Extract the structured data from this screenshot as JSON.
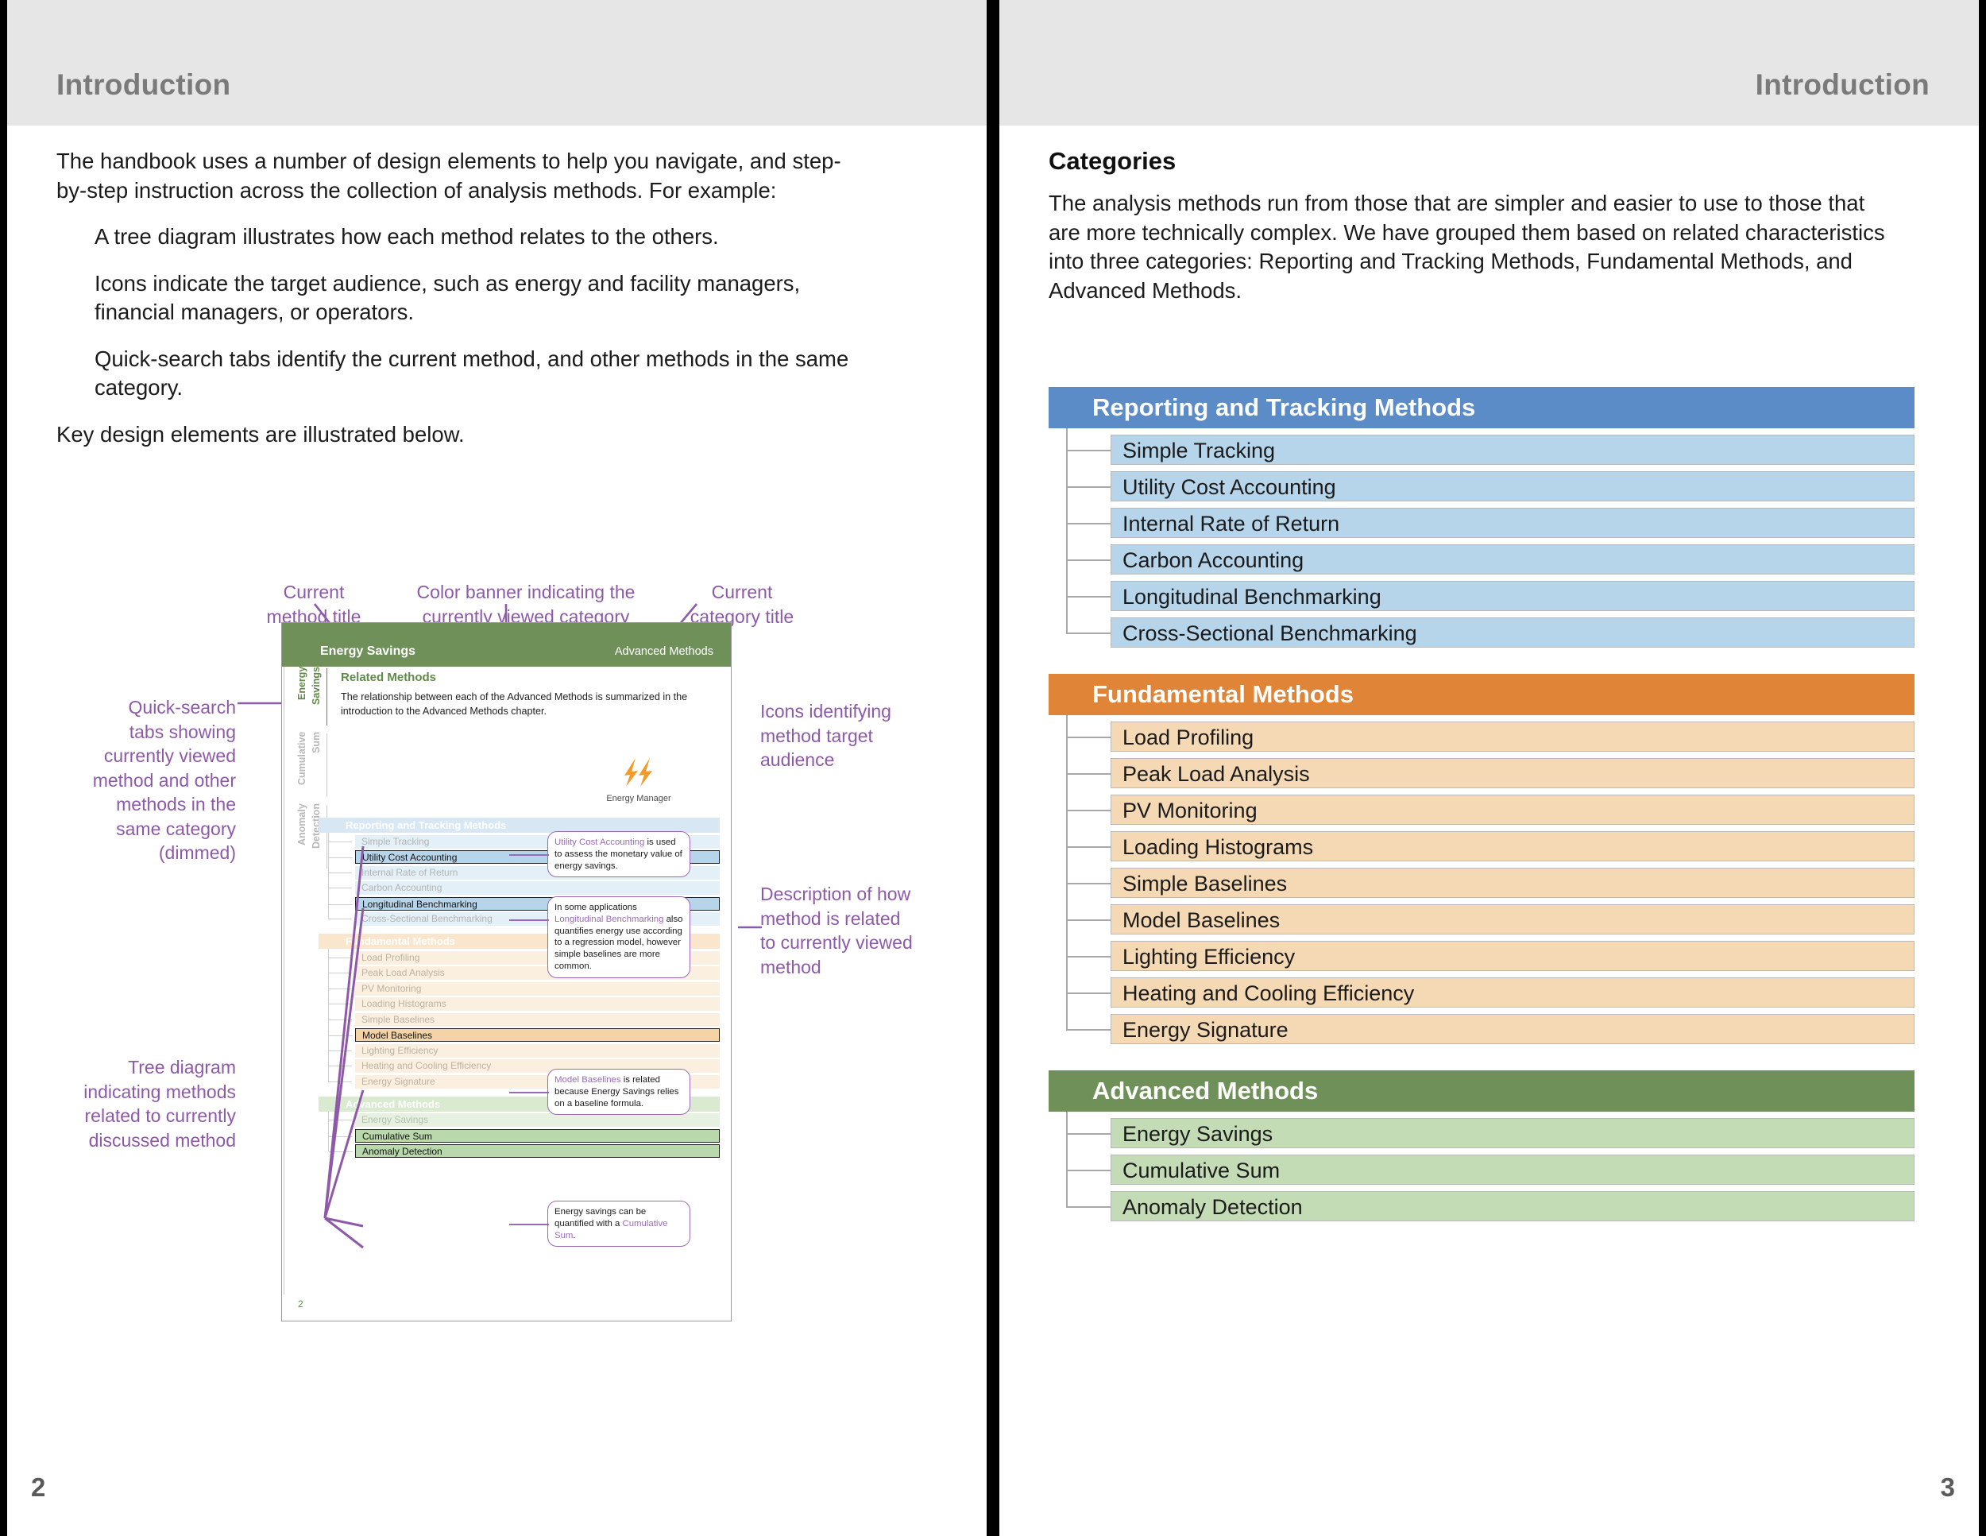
{
  "colors": {
    "blue_header": "#5b8cc8",
    "orange_header": "#e08537",
    "green_header": "#6f9159",
    "blue_item": "#b6d5ea",
    "orange_item": "#f4d9b4",
    "green_item": "#c4dcb5",
    "annotation_purple": "#8e5aa8",
    "header_band": "#e6e6e6"
  },
  "left_page": {
    "header_title": "Introduction",
    "folio": "2",
    "paragraphs": [
      {
        "indent": false,
        "text": "The handbook uses a number of design elements to help you navigate, and step-by-step instruction across the collection of analysis methods. For example:"
      },
      {
        "indent": true,
        "text": "A tree diagram illustrates how each method relates to the others."
      },
      {
        "indent": true,
        "text": "Icons indicate the target audience, such as energy and facility managers, financial managers, or operators."
      },
      {
        "indent": true,
        "text": "Quick-search tabs identify the current method, and other methods in the same category."
      },
      {
        "indent": false,
        "text": "Key design elements are illustrated below."
      }
    ],
    "annotations": {
      "current_method_title": "Current\nmethod title",
      "color_banner": "Color banner indicating the\ncurrently viewed category",
      "current_category_title": "Current\ncategory title",
      "quick_search_tabs": "Quick-search\ntabs showing\ncurrently viewed\nmethod and other\nmethods in the\nsame category\n(dimmed)",
      "tree_diagram": "Tree diagram\nindicating methods\nrelated to currently\ndiscussed method",
      "icons_audience": "Icons identifying\nmethod target\naudience",
      "description_related": "Description of how\nmethod is related\nto currently viewed\nmethod"
    },
    "mock_page": {
      "banner_method": "Energy Savings",
      "banner_category": "Advanced Methods",
      "folio": "2",
      "quick_tabs": [
        {
          "label_line1": "Energy",
          "label_line2": "Savings",
          "state": "active"
        },
        {
          "label_line1": "Cumulative",
          "label_line2": "Sum",
          "state": "dimmed"
        },
        {
          "label_line1": "Anomaly",
          "label_line2": "Detection",
          "state": "dimmed"
        }
      ],
      "related_methods_heading": "Related Methods",
      "related_methods_text": "The relationship between each of the Advanced Methods is summarized in the introduction to the Advanced Methods chapter.",
      "audience_icon_label": "Energy Manager",
      "audience_icon_name": "lightning-bolt-icon",
      "tree": [
        {
          "header": "Reporting and Tracking Methods",
          "color": "blue",
          "items": [
            {
              "label": "Simple Tracking",
              "highlighted": false
            },
            {
              "label": "Utility Cost Accounting",
              "highlighted": true
            },
            {
              "label": "Internal Rate of Return",
              "highlighted": false
            },
            {
              "label": "Carbon Accounting",
              "highlighted": false
            },
            {
              "label": "Longitudinal Benchmarking",
              "highlighted": true
            },
            {
              "label": "Cross-Sectional Benchmarking",
              "highlighted": false
            }
          ]
        },
        {
          "header": "Fundamental Methods",
          "color": "orange",
          "items": [
            {
              "label": "Load Profiling",
              "highlighted": false
            },
            {
              "label": "Peak Load Analysis",
              "highlighted": false
            },
            {
              "label": "PV Monitoring",
              "highlighted": false
            },
            {
              "label": "Loading Histograms",
              "highlighted": false
            },
            {
              "label": "Simple Baselines",
              "highlighted": false
            },
            {
              "label": "Model Baselines",
              "highlighted": true
            },
            {
              "label": "Lighting Efficiency",
              "highlighted": false
            },
            {
              "label": "Heating and Cooling Efficiency",
              "highlighted": false
            },
            {
              "label": "Energy Signature",
              "highlighted": false
            }
          ]
        },
        {
          "header": "Advanced Methods",
          "color": "green",
          "items": [
            {
              "label": "Energy Savings",
              "highlighted": false
            },
            {
              "label": "Cumulative Sum",
              "highlighted": true
            },
            {
              "label": "Anomaly Detection",
              "highlighted": true
            }
          ]
        }
      ],
      "callouts": [
        {
          "keyword": "Utility Cost Accounting",
          "rest": " is used to assess the monetary value of energy savings.",
          "keyword_first": true
        },
        {
          "lead": "In some applications ",
          "keyword": "Longitudinal Benchmarking",
          "rest": " also quantifies energy use according to a regression model, however simple baselines are more common.",
          "keyword_first": false
        },
        {
          "keyword": "Model Baselines",
          "rest": " is related because Energy Savings relies on a baseline formula.",
          "keyword_first": true
        },
        {
          "lead": "Energy savings can be quantified with a ",
          "keyword": "Cumulative Sum",
          "rest": ".",
          "keyword_first": false
        }
      ]
    }
  },
  "right_page": {
    "header_title": "Introduction",
    "folio": "3",
    "section_title": "Categories",
    "intro_text": "The  analysis methods run from those that are simpler and easier to use to those that are more technically complex.  We have grouped them based on related characteristics into three categories: Reporting and Tracking Methods, Fundamental Methods, and Advanced Methods.",
    "categories": [
      {
        "title": "Reporting and Tracking Methods",
        "color": "blue",
        "items": [
          "Simple Tracking",
          "Utility Cost Accounting",
          "Internal Rate of Return",
          "Carbon Accounting",
          "Longitudinal Benchmarking",
          "Cross-Sectional Benchmarking"
        ]
      },
      {
        "title": "Fundamental Methods",
        "color": "orange",
        "items": [
          "Load Profiling",
          "Peak Load Analysis",
          "PV Monitoring",
          "Loading Histograms",
          "Simple Baselines",
          "Model Baselines",
          "Lighting Efficiency",
          "Heating and Cooling Efficiency",
          "Energy Signature"
        ]
      },
      {
        "title": "Advanced Methods",
        "color": "green",
        "items": [
          "Energy Savings",
          "Cumulative Sum",
          "Anomaly Detection"
        ]
      }
    ]
  }
}
